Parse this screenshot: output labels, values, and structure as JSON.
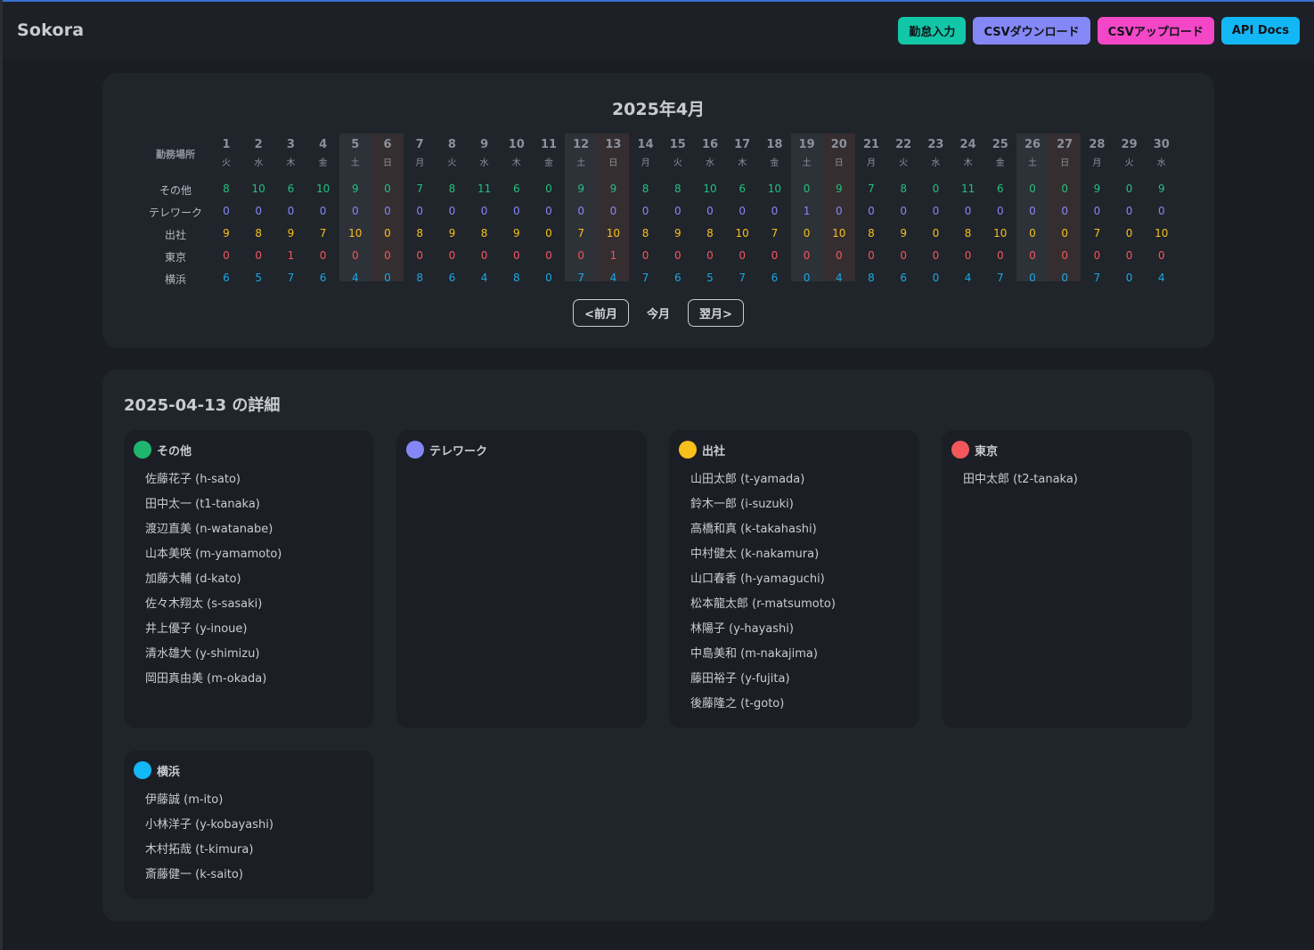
{
  "header": {
    "brand": "Sokora",
    "buttons": [
      {
        "label": "勤怠入力",
        "color": "#12c7a7"
      },
      {
        "label": "CSVダウンロード",
        "color": "#8488f6"
      },
      {
        "label": "CSVアップロード",
        "color": "#f447c7"
      },
      {
        "label": "API Docs",
        "color": "#12b7f5"
      }
    ]
  },
  "calendar": {
    "title": "2025年4月",
    "header_label": "勤務場所",
    "days": [
      "1",
      "2",
      "3",
      "4",
      "5",
      "6",
      "7",
      "8",
      "9",
      "10",
      "11",
      "12",
      "13",
      "14",
      "15",
      "16",
      "17",
      "18",
      "19",
      "20",
      "21",
      "22",
      "23",
      "24",
      "25",
      "26",
      "27",
      "28",
      "29",
      "30"
    ],
    "weekdays": [
      "火",
      "水",
      "木",
      "金",
      "土",
      "日",
      "月",
      "火",
      "水",
      "木",
      "金",
      "土",
      "日",
      "月",
      "火",
      "水",
      "木",
      "金",
      "土",
      "日",
      "月",
      "火",
      "水",
      "木",
      "金",
      "土",
      "日",
      "月",
      "火",
      "水"
    ],
    "rows": [
      {
        "label": "その他",
        "color": "#22c17f",
        "values": [
          "8",
          "10",
          "6",
          "10",
          "9",
          "0",
          "7",
          "8",
          "11",
          "6",
          "0",
          "9",
          "9",
          "8",
          "8",
          "10",
          "6",
          "10",
          "0",
          "9",
          "7",
          "8",
          "0",
          "11",
          "6",
          "0",
          "0",
          "9",
          "0",
          "9"
        ]
      },
      {
        "label": "テレワーク",
        "color": "#8488f6",
        "values": [
          "0",
          "0",
          "0",
          "0",
          "0",
          "0",
          "0",
          "0",
          "0",
          "0",
          "0",
          "0",
          "0",
          "0",
          "0",
          "0",
          "0",
          "0",
          "1",
          "0",
          "0",
          "0",
          "0",
          "0",
          "0",
          "0",
          "0",
          "0",
          "0",
          "0"
        ]
      },
      {
        "label": "出社",
        "color": "#f7c01a",
        "values": [
          "9",
          "8",
          "9",
          "7",
          "10",
          "0",
          "8",
          "9",
          "8",
          "9",
          "0",
          "7",
          "10",
          "8",
          "9",
          "8",
          "10",
          "7",
          "0",
          "10",
          "8",
          "9",
          "0",
          "8",
          "10",
          "0",
          "0",
          "7",
          "0",
          "10"
        ]
      },
      {
        "label": "東京",
        "color": "#f3575b",
        "values": [
          "0",
          "0",
          "1",
          "0",
          "0",
          "0",
          "0",
          "0",
          "0",
          "0",
          "0",
          "0",
          "1",
          "0",
          "0",
          "0",
          "0",
          "0",
          "0",
          "0",
          "0",
          "0",
          "0",
          "0",
          "0",
          "0",
          "0",
          "0",
          "0",
          "0"
        ]
      },
      {
        "label": "横浜",
        "color": "#19a9e6",
        "values": [
          "6",
          "5",
          "7",
          "6",
          "4",
          "0",
          "8",
          "6",
          "4",
          "8",
          "0",
          "7",
          "4",
          "7",
          "6",
          "5",
          "7",
          "6",
          "0",
          "4",
          "8",
          "6",
          "0",
          "4",
          "7",
          "0",
          "0",
          "7",
          "0",
          "4"
        ]
      }
    ],
    "prev_label": "<前月",
    "today_label": "今月",
    "next_label": "翌月>"
  },
  "detail": {
    "title": "2025-04-13 の詳細",
    "locations": [
      {
        "name": "その他",
        "color": "#1fb56f",
        "members": [
          "佐藤花子 (h-sato)",
          "田中太一 (t1-tanaka)",
          "渡辺直美 (n-watanabe)",
          "山本美咲 (m-yamamoto)",
          "加藤大輔 (d-kato)",
          "佐々木翔太 (s-sasaki)",
          "井上優子 (y-inoue)",
          "清水雄大 (y-shimizu)",
          "岡田真由美 (m-okada)"
        ]
      },
      {
        "name": "テレワーク",
        "color": "#8488f6",
        "members": []
      },
      {
        "name": "出社",
        "color": "#f7c01a",
        "members": [
          "山田太郎 (t-yamada)",
          "鈴木一郎 (i-suzuki)",
          "高橋和真 (k-takahashi)",
          "中村健太 (k-nakamura)",
          "山口春香 (h-yamaguchi)",
          "松本龍太郎 (r-matsumoto)",
          "林陽子 (y-hayashi)",
          "中島美和 (m-nakajima)",
          "藤田裕子 (y-fujita)",
          "後藤隆之 (t-goto)"
        ]
      },
      {
        "name": "東京",
        "color": "#f3575b",
        "members": [
          "田中太郎 (t2-tanaka)"
        ]
      },
      {
        "name": "横浜",
        "color": "#12b7f5",
        "members": [
          "伊藤誠 (m-ito)",
          "小林洋子 (y-kobayashi)",
          "木村拓哉 (t-kimura)",
          "斎藤健一 (k-saito)"
        ]
      }
    ]
  }
}
